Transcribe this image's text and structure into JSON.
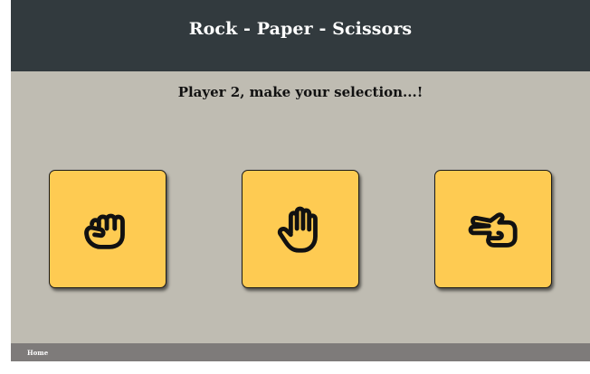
{
  "header": {
    "title": "Rock - Paper - Scissors"
  },
  "game": {
    "prompt": "Player 2, make your selection...!",
    "choices": [
      {
        "id": "rock",
        "icon": "fist-icon"
      },
      {
        "id": "paper",
        "icon": "open-hand-icon"
      },
      {
        "id": "scissors",
        "icon": "scissors-hand-icon"
      }
    ]
  },
  "footer": {
    "home_label": "Home"
  },
  "colors": {
    "header_bg": "#323a3e",
    "page_bg": "#bfbcb2",
    "card_bg": "#fecb52",
    "footer_bg": "#7e7b7a"
  }
}
